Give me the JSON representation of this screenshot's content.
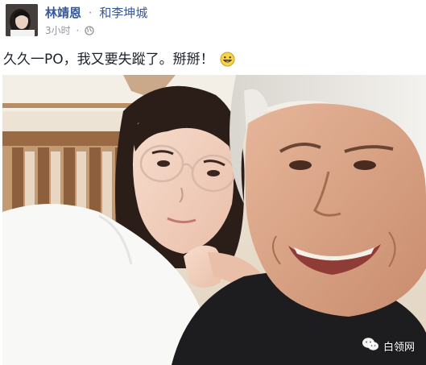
{
  "post": {
    "author": "林靖恩",
    "with_sep": "·",
    "with_name": "和李坤城",
    "time": "3小时",
    "meta_dot": "·",
    "privacy_icon": "globe-icon",
    "text": "久久一PO，我又要失蹤了。掰掰！",
    "emoji_icon": "grinning-face-icon"
  },
  "photo": {
    "description_icon": "selfie-photo",
    "watermark": {
      "icon": "wechat-icon",
      "text": "白领网"
    }
  },
  "colors": {
    "link": "#365899",
    "meta": "#90949c",
    "text": "#1d2129"
  }
}
